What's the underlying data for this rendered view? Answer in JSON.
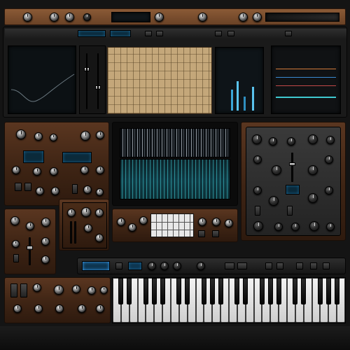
{
  "app": {
    "title": "",
    "colors": {
      "wood": "#5a3620",
      "panel": "#1c1c1c",
      "lcd": "#0b2a3a",
      "accent_blue": "#4fc3f7",
      "accent_teal": "#3fd0d4"
    }
  },
  "top_rack": {
    "display_text": ""
  },
  "header_displays": {
    "lcd_left": "",
    "lcd_right": ""
  },
  "modules": {
    "eq_plot": {
      "name": ""
    },
    "piano_roll": {
      "name": ""
    },
    "meter": {
      "name": ""
    },
    "scope": {
      "name": ""
    },
    "waveform": {
      "name": ""
    },
    "spectrogram": {
      "name": ""
    },
    "synth_left": {
      "name": ""
    },
    "synth_right": {
      "name": ""
    },
    "sequencer": {
      "name": ""
    }
  },
  "keyboard": {
    "lcd_left": "",
    "lcd_right": "",
    "white_keys": 28
  },
  "icons": [
    "knob-icon",
    "button-icon",
    "fader-icon",
    "display-icon",
    "key-icon"
  ]
}
